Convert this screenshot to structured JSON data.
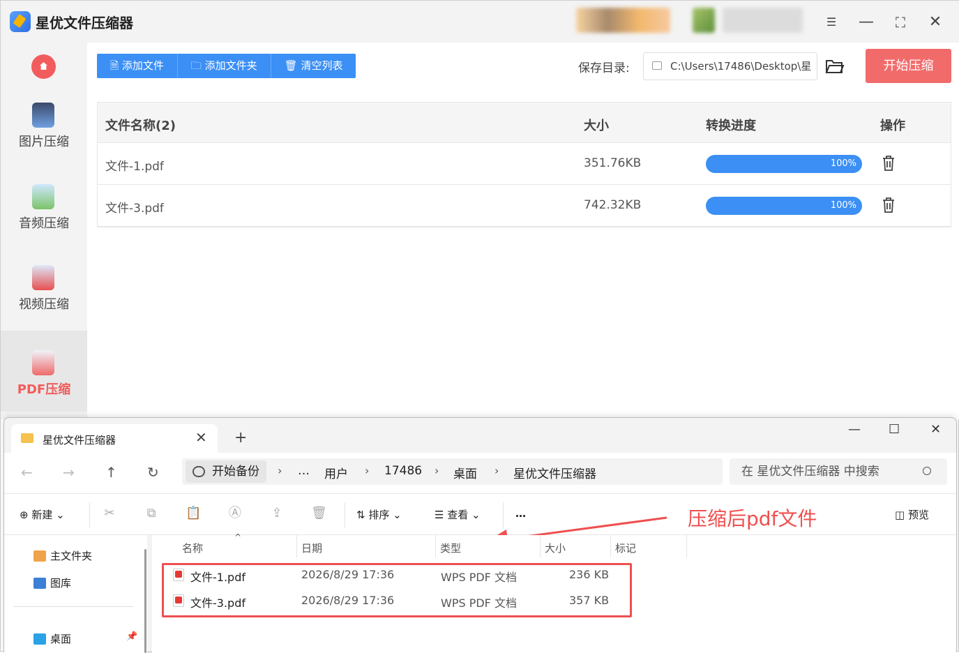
{
  "app": {
    "title": "星优文件压缩器",
    "window_controls": [
      "minimize",
      "maximize",
      "close"
    ]
  },
  "sidebar": {
    "items": [
      {
        "label": "图片压缩",
        "icon": "image-icon",
        "active": false
      },
      {
        "label": "音频压缩",
        "icon": "music-icon",
        "active": false
      },
      {
        "label": "视频压缩",
        "icon": "video-icon",
        "active": false
      },
      {
        "label": "PDF压缩",
        "icon": "pdf-icon",
        "active": true
      }
    ]
  },
  "toolbar": {
    "add_file": "添加文件",
    "add_folder": "添加文件夹",
    "clear_list": "清空列表"
  },
  "save": {
    "label": "保存目录:",
    "path": "C:\\Users\\17486\\Desktop\\星"
  },
  "start_button": "开始压缩",
  "table": {
    "headers": {
      "name": "文件名称(2)",
      "size": "大小",
      "progress": "转换进度",
      "action": "操作"
    },
    "rows": [
      {
        "name": "文件-1.pdf",
        "size": "351.76KB",
        "progress": "100%",
        "progress_value": 1.0
      },
      {
        "name": "文件-3.pdf",
        "size": "742.32KB",
        "progress": "100%",
        "progress_value": 1.0
      }
    ]
  },
  "explorer": {
    "tab_title": "星优文件压缩器",
    "breadcrumbs": [
      "开始备份",
      "…",
      "用户",
      "17486",
      "桌面",
      "星优文件压缩器"
    ],
    "search_placeholder": "在 星优文件压缩器 中搜索",
    "commands": {
      "new": "新建",
      "sort": "排序",
      "view": "查看",
      "more": "…",
      "preview": "预览"
    },
    "nav_pane": [
      {
        "label": "主文件夹",
        "icon": "home-icon"
      },
      {
        "label": "图库",
        "icon": "gallery-icon"
      },
      {
        "label": "桌面",
        "icon": "desktop-icon"
      }
    ],
    "columns": {
      "name": "名称",
      "date": "日期",
      "type": "类型",
      "size": "大小",
      "tag": "标记"
    },
    "files": [
      {
        "name": "文件-1.pdf",
        "date": "2026/8/29 17:36",
        "type": "WPS PDF 文档",
        "size": "236 KB"
      },
      {
        "name": "文件-3.pdf",
        "date": "2026/8/29 17:36",
        "type": "WPS PDF 文档",
        "size": "357 KB"
      }
    ]
  },
  "annotation": {
    "text": "压缩后pdf文件",
    "color": "#ef4f4f"
  },
  "colors": {
    "accent_blue": "#3b8ff5",
    "accent_red": "#f26b6b"
  }
}
